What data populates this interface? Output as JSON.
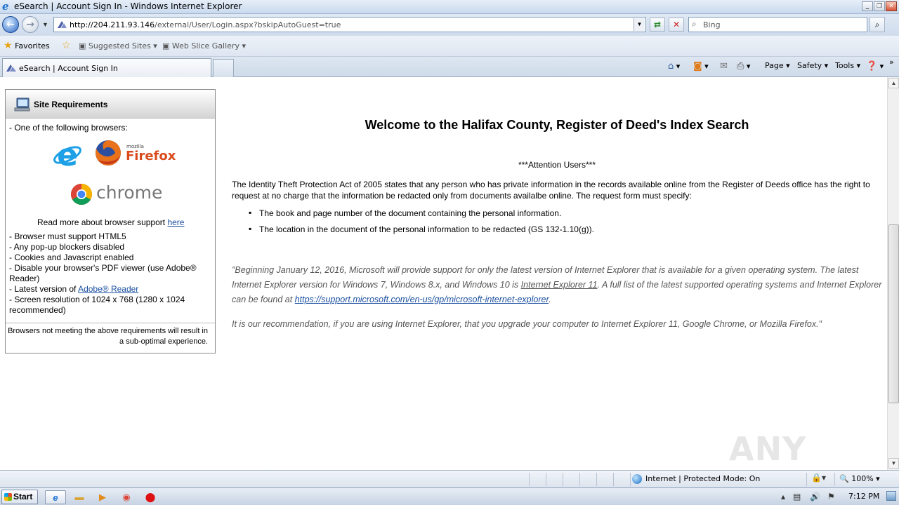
{
  "window": {
    "title": "eSearch | Account Sign In - Windows Internet Explorer"
  },
  "navbar": {
    "url_host": "http://204.211.93.146",
    "url_path": "/external/User/Login.aspx?bskipAutoGuest=true",
    "search_placeholder": "Bing"
  },
  "favorites_bar": {
    "favorites_label": "Favorites",
    "suggested_sites": "Suggested Sites",
    "web_slice_gallery": "Web Slice Gallery"
  },
  "tabs": [
    {
      "label": "eSearch | Account Sign In"
    }
  ],
  "command_bar": {
    "page": "Page",
    "safety": "Safety",
    "tools": "Tools"
  },
  "sidebar": {
    "heading": "Site Requirements",
    "browsers_intro": "- One of the following browsers:",
    "firefox_small": "mozilla",
    "firefox": "Firefox",
    "chrome": "chrome",
    "read_more": "Read more about browser support",
    "read_more_link": "here",
    "req_html5": "- Browser must support HTML5",
    "req_popup": "- Any pop-up blockers disabled",
    "req_cookies": "- Cookies and Javascript enabled",
    "req_pdf_1": "- Disable your browser's PDF viewer (use Adobe®",
    "req_pdf_2": "Reader)",
    "req_adobe_prefix": "- Latest version of",
    "req_adobe_link": "Adobe® Reader",
    "req_res_1": "- Screen resolution of 1024 x 768 (1280 x 1024",
    "req_res_2": "recommended)",
    "footer": "Browsers not meeting the above requirements will result in a sub-optimal experience."
  },
  "main": {
    "welcome": "Welcome to the Halifax County, Register of Deed's Index Search",
    "attention": "***Attention Users***",
    "paragraph": "The Identity Theft Protection Act of 2005 states that any person who has private information in the records available online from the Register of Deeds office has the right to request at no charge that the information be redacted only from documents availalbe online.  The request form must specify:",
    "bullets": [
      "The book and page number of the document containing the personal information.",
      "The location in the document of the personal information to be redacted (GS 132-1.10(g))."
    ],
    "quote_part1": "\"Beginning January 12, 2016, Microsoft will provide support for only the latest version of Internet Explorer that is available for a given operating system. The latest Internet Explorer version for Windows 7, Windows 8.x, and Windows 10 is",
    "quote_ie11": "Internet Explorer 11",
    "quote_part2": ". A full list of the latest supported operating systems and Internet Explorer can be found at",
    "quote_link": "https://support.microsoft.com/en-us/gp/microsoft-internet-explorer",
    "quote_part3": ".",
    "recommendation": "It is our recommendation, if you are using Internet Explorer, that you upgrade your computer to Internet Explorer 11, Google Chrome, or Mozilla Firefox.\""
  },
  "watermark": "ANY RUN",
  "statusbar": {
    "zone": "Internet | Protected Mode: On",
    "zoom": "100%"
  },
  "taskbar": {
    "start": "Start",
    "clock": "7:12 PM"
  }
}
